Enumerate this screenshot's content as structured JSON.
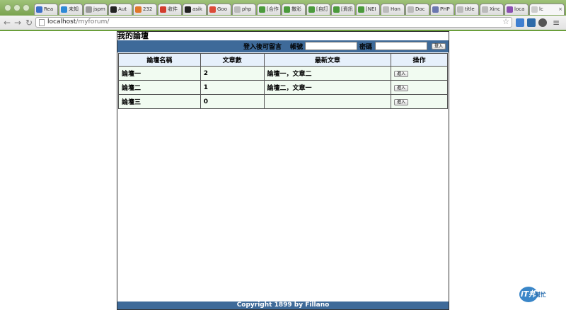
{
  "browser": {
    "tabs": [
      {
        "label": "Rea",
        "color": "#3b6fc8"
      },
      {
        "label": "未知",
        "color": "#2f8ad6"
      },
      {
        "label": "jspm",
        "color": "#9a9a9a"
      },
      {
        "label": "Aut",
        "color": "#222222"
      },
      {
        "label": "232",
        "color": "#e0772a"
      },
      {
        "label": "收件",
        "color": "#d23c2c"
      },
      {
        "label": "asik",
        "color": "#222222"
      },
      {
        "label": "Goo",
        "color": "#dc4b38"
      },
      {
        "label": "php",
        "color": "#bbbbbb"
      },
      {
        "label": "[合作",
        "color": "#4b9a3c"
      },
      {
        "label": "撒彩",
        "color": "#4b9a3c"
      },
      {
        "label": "[自訂",
        "color": "#4b9a3c"
      },
      {
        "label": "[資訊",
        "color": "#4b9a3c"
      },
      {
        "label": "[NEI",
        "color": "#4b9a3c"
      },
      {
        "label": "Hon",
        "color": "#bbbbbb"
      },
      {
        "label": "Doc",
        "color": "#bbbbbb"
      },
      {
        "label": "PHP",
        "color": "#6b78b0"
      },
      {
        "label": "title",
        "color": "#bbbbbb"
      },
      {
        "label": "Xinc",
        "color": "#bbbbbb"
      },
      {
        "label": "loca",
        "color": "#8b4fb0"
      }
    ],
    "active_tab": {
      "label": "lc",
      "close": "×"
    },
    "url_host": "localhost",
    "url_path": "/myforum/",
    "back_glyph": "←",
    "forward_glyph": "→",
    "reload_glyph": "↻",
    "star_glyph": "☆",
    "menu_glyph": "≡"
  },
  "site": {
    "title": "我的論壇",
    "login_message": "登入後可留言",
    "account_label": "帳號",
    "password_label": "密碼",
    "login_button": "登入"
  },
  "table": {
    "headers": [
      "論壇名稱",
      "文章數",
      "最新文章",
      "操作"
    ],
    "rows": [
      {
        "name": "論壇一",
        "count": "2",
        "latest": "論壇一，文章二",
        "action": "進入"
      },
      {
        "name": "論壇二",
        "count": "1",
        "latest": "論壇二，文章一",
        "action": "進入"
      },
      {
        "name": "論壇三",
        "count": "0",
        "latest": "",
        "action": "進入"
      }
    ]
  },
  "footer": {
    "text": "Copyright 1899 by Fillano"
  },
  "watermark": {
    "badge": "iT邦",
    "sub": "幫忙"
  }
}
